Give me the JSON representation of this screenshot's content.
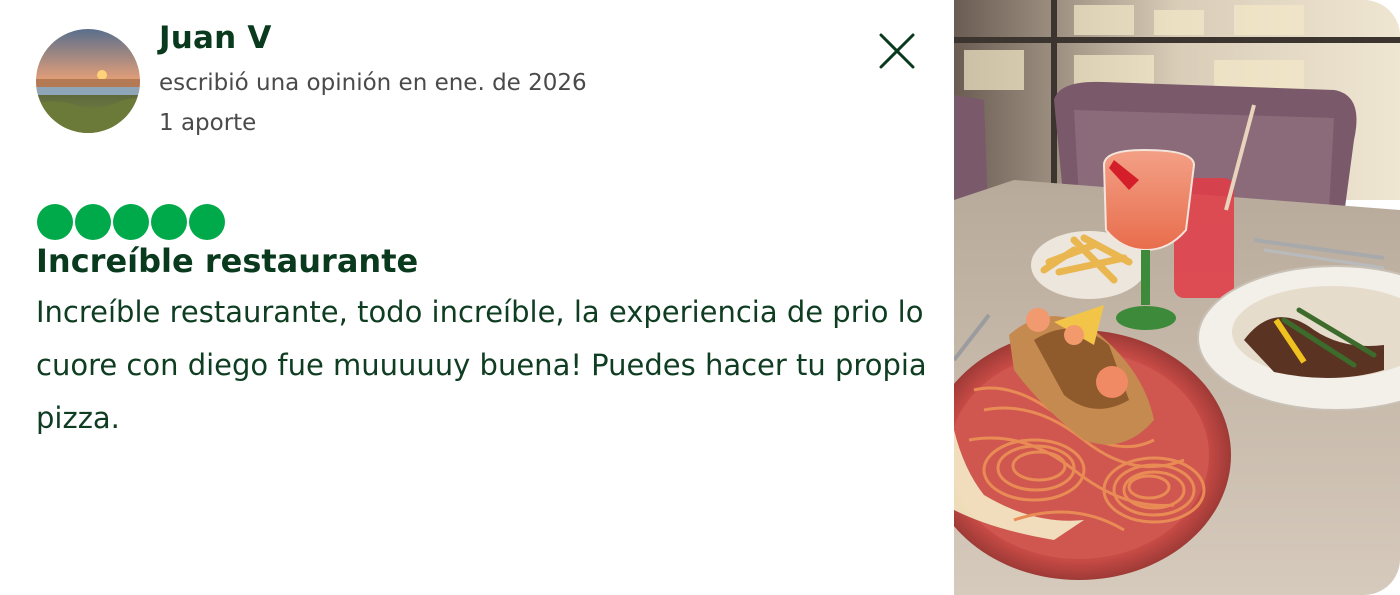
{
  "review": {
    "author_name": "Juan V",
    "written_line": "escribió una opinión en ene. de 2026",
    "contributions": "1 aporte",
    "rating": 5,
    "rating_max": 5,
    "title": "Increíble restaurante",
    "text": "Increíble restaurante, todo increíble, la experiencia de prio lo cuore con diego fue muuuuuy buena! Puedes hacer tu propia pizza."
  },
  "icons": {
    "close": "close-icon",
    "rating_bubble": "rating-bubble-icon"
  },
  "colors": {
    "brand_green": "#00aa4a",
    "text_dark_green": "#0a3a1e",
    "meta_gray": "#4a4a4a"
  }
}
